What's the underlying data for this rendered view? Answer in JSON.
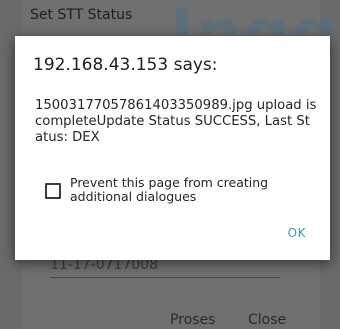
{
  "background": {
    "header_title": "Set STT Status",
    "watermark_text": "Jngg",
    "field_value": "11-17-0717008",
    "buttons": {
      "proses_label": "Proses",
      "close_label": "Close"
    }
  },
  "dialog": {
    "title": "192.168.43.153 says:",
    "message": "150031770578614033509­89.jpg upload is completeUpdate Status SUCCESS, Last Status: DEX",
    "prevent_checkbox": {
      "label": "Prevent this page from creating additional dialogues",
      "checked": false
    },
    "ok_label": "OK",
    "accent_color": "#2f9cd1"
  }
}
